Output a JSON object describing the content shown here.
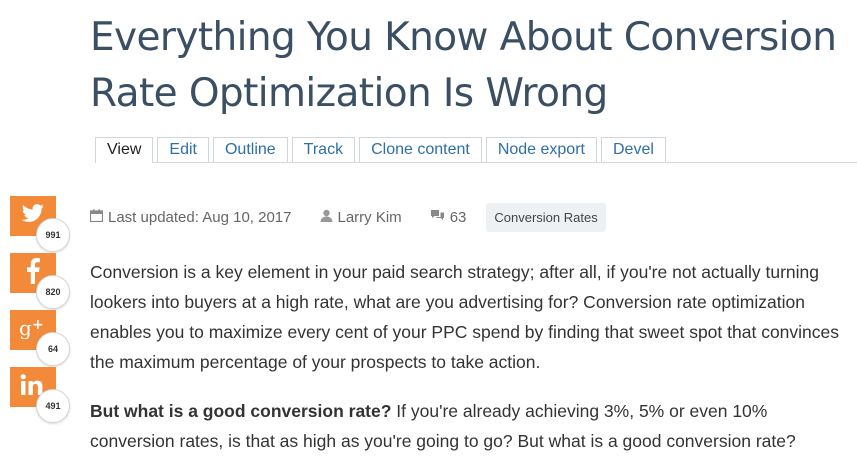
{
  "article": {
    "title_line1": "Everything You Know About Conversion",
    "title_line2": "Rate Optimization Is Wrong"
  },
  "tabs": [
    {
      "label": "View",
      "active": true
    },
    {
      "label": "Edit"
    },
    {
      "label": "Outline"
    },
    {
      "label": "Track"
    },
    {
      "label": "Clone content"
    },
    {
      "label": "Node export"
    },
    {
      "label": "Devel"
    }
  ],
  "share": [
    {
      "network": "twitter",
      "icon": "twitter-icon",
      "count": "991"
    },
    {
      "network": "facebook",
      "icon": "facebook-icon",
      "count": "820"
    },
    {
      "network": "google-plus",
      "icon": "google-plus-icon",
      "count": "64"
    },
    {
      "network": "linkedin",
      "icon": "linkedin-icon",
      "count": "491"
    }
  ],
  "share_color": "#f38a3a",
  "meta": {
    "last_updated": "Last updated: Aug 10, 2017",
    "author": "Larry Kim",
    "comments": "63",
    "category": "Conversion Rates"
  },
  "body": {
    "paragraph1": "Conversion is a key element in your paid search strategy; after all, if you're not actually turning lookers into buyers at a high rate, what are you advertising for? Conversion rate optimization enables you to maximize every cent of your PPC spend by finding that sweet spot that convinces the maximum percentage of your prospects to take action.",
    "paragraph2_bold": "But what is a good conversion rate?",
    "paragraph2_rest": " If you're already achieving 3%, 5% or even 10% conversion rates, is that as high as you're going to go? But what is a good conversion rate?"
  }
}
